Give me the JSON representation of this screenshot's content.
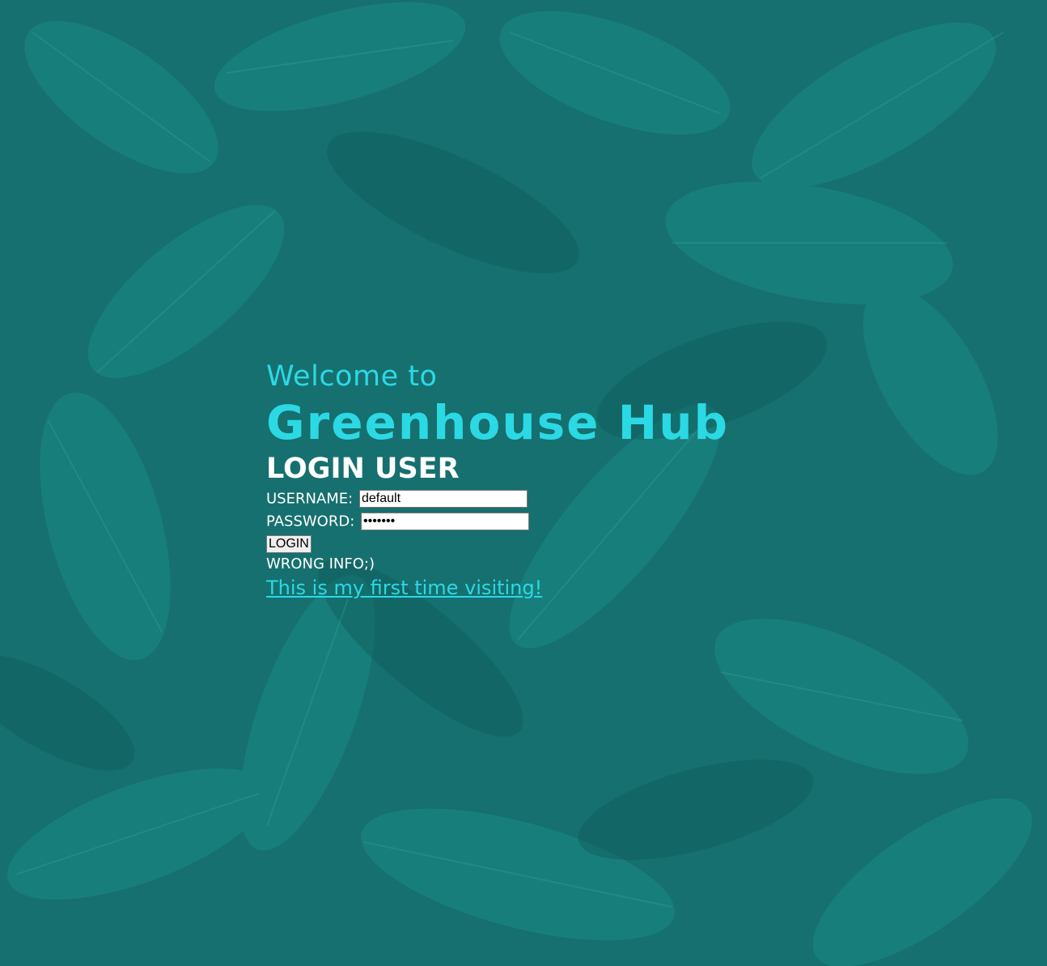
{
  "hero": {
    "welcome": "Welcome to",
    "brand": "Greenhouse Hub"
  },
  "form": {
    "title": "LOGIN USER",
    "username_label": "USERNAME:",
    "username_value": "default",
    "password_label": "PASSWORD:",
    "password_value": "•••••••",
    "login_button": "LOGIN",
    "status_message": "WRONG INFO;)",
    "first_visit_link": "This is my first time visiting!"
  },
  "colors": {
    "background": "#16706f",
    "accent": "#2bd9e4",
    "text": "#ffffff"
  },
  "background_image": "leaf-pattern"
}
